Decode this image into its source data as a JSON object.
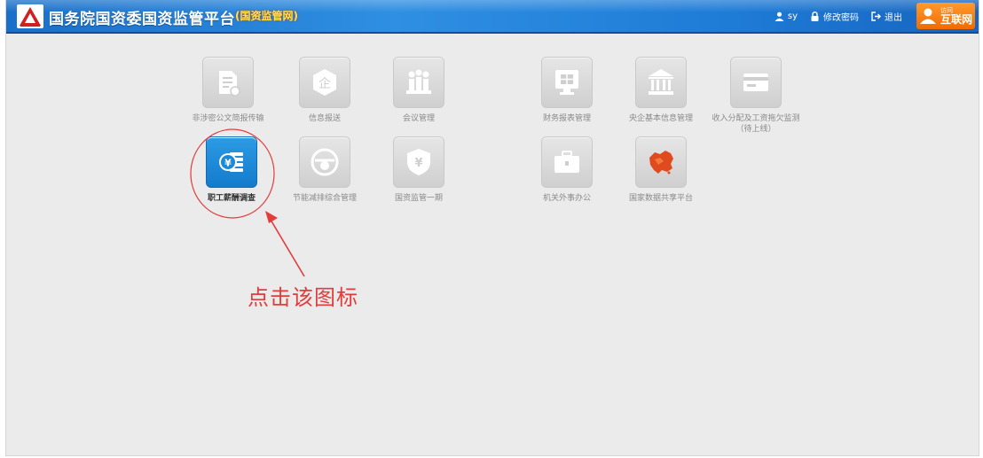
{
  "header": {
    "title": "国务院国资委国资监管平台",
    "subtitle": "(国资监管网)",
    "user": "sy",
    "change_password": "修改密码",
    "logout": "退出",
    "badge_small": "访问",
    "badge_big": "互联网"
  },
  "tiles": [
    {
      "label": "非涉密公文简报传输",
      "icon": "document-icon"
    },
    {
      "label": "信息报送",
      "icon": "enterprise-icon"
    },
    {
      "label": "会议管理",
      "icon": "meeting-icon"
    },
    {
      "label": "财务报表管理",
      "icon": "monitor-icon"
    },
    {
      "label": "央企基本信息管理",
      "icon": "building-icon"
    },
    {
      "label": "收入分配及工资拖欠监测（待上线）",
      "icon": "card-icon"
    },
    {
      "label": "职工薪酬调查",
      "icon": "salary-coin-icon"
    },
    {
      "label": "节能减排综合管理",
      "icon": "energy-icon"
    },
    {
      "label": "国资监管一期",
      "icon": "shield-yuan-icon"
    },
    {
      "label": "机关外事办公",
      "icon": "briefcase-icon"
    },
    {
      "label": "国家数据共享平台",
      "icon": "china-map-icon"
    }
  ],
  "annotation": {
    "text": "点击该图标",
    "color": "#e43b3b"
  },
  "colors": {
    "header_blue": "#1e7bd6",
    "active_tile": "#1a8ad8",
    "background": "#ebebeb"
  }
}
